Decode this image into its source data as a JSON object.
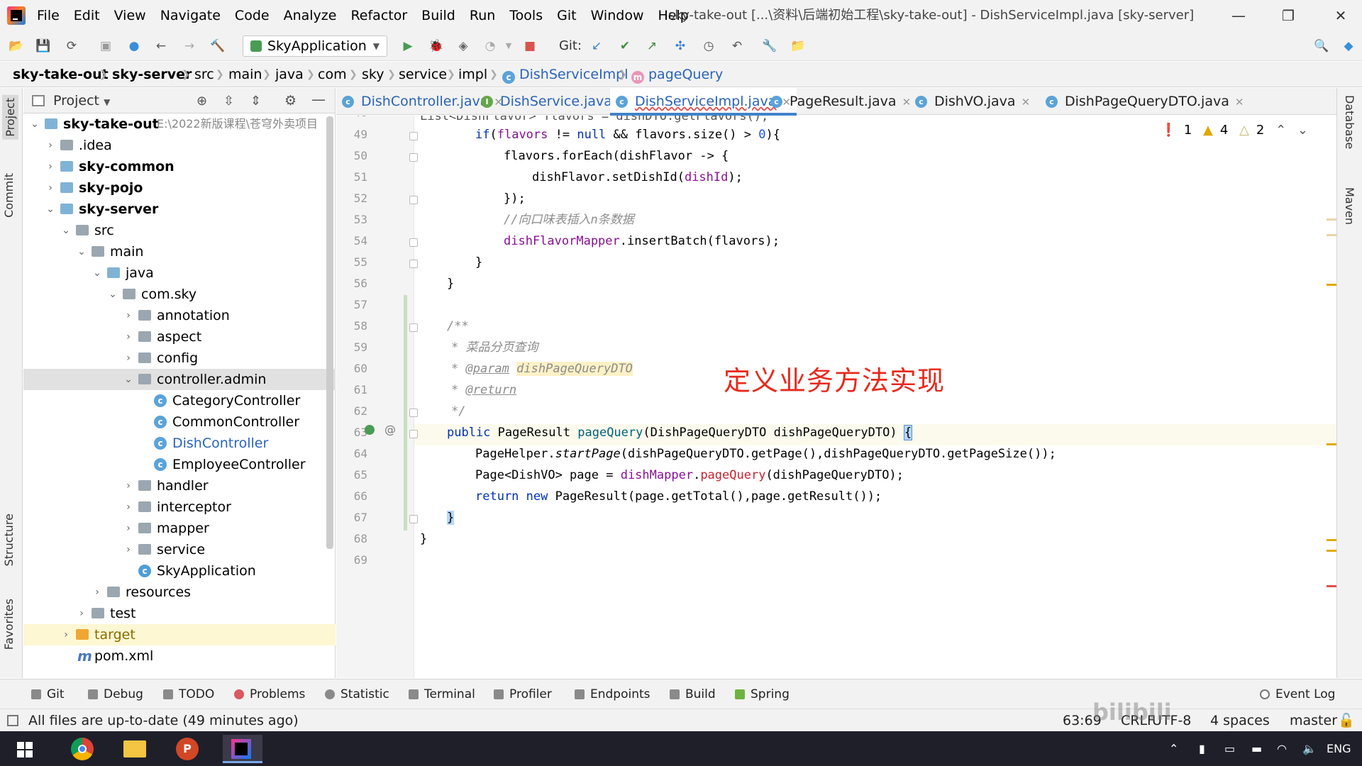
{
  "window": {
    "title": "sky-take-out [...\\资料\\后端初始工程\\sky-take-out] - DishServiceImpl.java [sky-server]"
  },
  "menu": [
    "File",
    "Edit",
    "View",
    "Navigate",
    "Code",
    "Analyze",
    "Refactor",
    "Build",
    "Run",
    "Tools",
    "Git",
    "Window",
    "Help"
  ],
  "toolbar": {
    "run_config": "SkyApplication",
    "git_label": "Git:"
  },
  "breadcrumb": [
    "sky-take-out",
    "sky-server",
    "src",
    "main",
    "java",
    "com",
    "sky",
    "service",
    "impl",
    "DishServiceImpl",
    "pageQuery"
  ],
  "left_tabs": {
    "project": "Project",
    "commit": "Commit",
    "structure": "Structure",
    "favorites": "Favorites"
  },
  "project_panel": {
    "title": "Project",
    "tree": [
      {
        "label": "sky-take-out",
        "extra": "E:\\2022新版课程\\苍穹外卖项目"
      },
      {
        "label": ".idea"
      },
      {
        "label": "sky-common"
      },
      {
        "label": "sky-pojo"
      },
      {
        "label": "sky-server"
      },
      {
        "label": "src"
      },
      {
        "label": "main"
      },
      {
        "label": "java"
      },
      {
        "label": "com.sky"
      },
      {
        "label": "annotation"
      },
      {
        "label": "aspect"
      },
      {
        "label": "config"
      },
      {
        "label": "controller.admin"
      },
      {
        "label": "CategoryController"
      },
      {
        "label": "CommonController"
      },
      {
        "label": "DishController"
      },
      {
        "label": "EmployeeController"
      },
      {
        "label": "handler"
      },
      {
        "label": "interceptor"
      },
      {
        "label": "mapper"
      },
      {
        "label": "service"
      },
      {
        "label": "SkyApplication"
      },
      {
        "label": "resources"
      },
      {
        "label": "test"
      },
      {
        "label": "target"
      },
      {
        "label": "pom.xml"
      }
    ]
  },
  "tabs": [
    {
      "label": "DishController.java"
    },
    {
      "label": "DishService.java"
    },
    {
      "label": "DishServiceImpl.java"
    },
    {
      "label": "PageResult.java"
    },
    {
      "label": "DishVO.java"
    },
    {
      "label": "DishPageQueryDTO.java"
    }
  ],
  "editor": {
    "line_numbers": [
      "49",
      "50",
      "51",
      "52",
      "53",
      "54",
      "55",
      "56",
      "57",
      "58",
      "59",
      "60",
      "61",
      "62",
      "63",
      "64",
      "65",
      "66",
      "67",
      "68",
      "69"
    ],
    "partial_top": "List<DishFlavor> flavors = dishDTO.getFlavors();",
    "overlay_caption": "定义业务方法实现",
    "inspections": {
      "errors": "1",
      "warnings": "4",
      "weak": "2"
    }
  },
  "right_tabs": {
    "database": "Database",
    "maven": "Maven"
  },
  "tool_windows": [
    "Git",
    "Debug",
    "TODO",
    "Problems",
    "Statistic",
    "Terminal",
    "Profiler",
    "Endpoints",
    "Build",
    "Spring"
  ],
  "event_log": "Event Log",
  "status": {
    "message": "All files are up-to-date (49 minutes ago)",
    "position": "63:69",
    "line_sep": "CRLF",
    "encoding": "UTF-8",
    "indent": "4 spaces",
    "branch": "master"
  },
  "taskbar": {
    "lang": "ENG"
  },
  "colors": {
    "accent": "#4083c9",
    "overlay": "#e8291c",
    "keyword": "#0033b3",
    "field": "#871094",
    "comment": "#8c8c8c"
  }
}
